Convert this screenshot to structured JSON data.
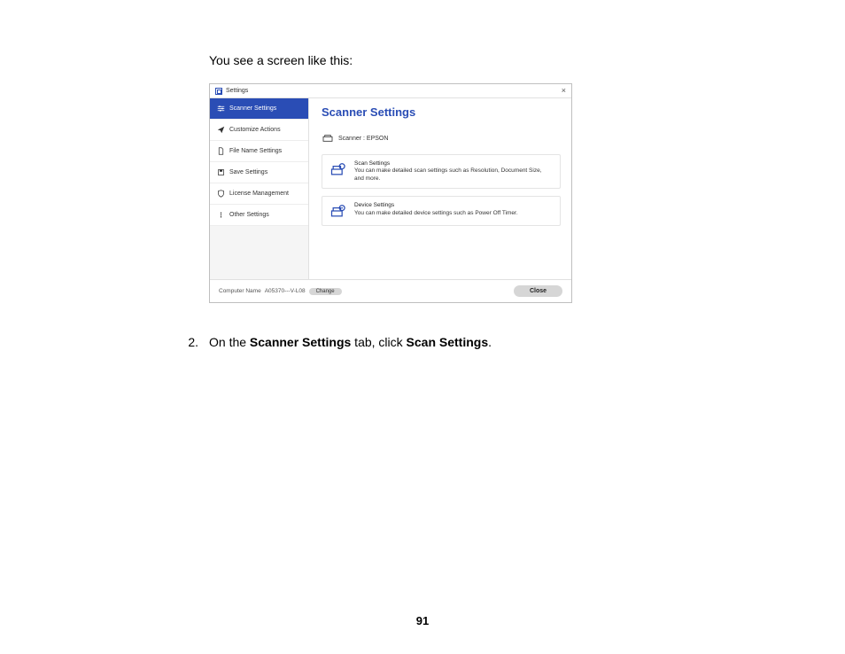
{
  "intro_text": "You see a screen like this:",
  "screenshot": {
    "window_title": "Settings",
    "close_glyph": "×",
    "sidebar": {
      "items": [
        {
          "label": "Scanner Settings"
        },
        {
          "label": "Customize Actions"
        },
        {
          "label": "File Name Settings"
        },
        {
          "label": "Save Settings"
        },
        {
          "label": "License Management"
        },
        {
          "label": "Other Settings"
        }
      ]
    },
    "main": {
      "heading": "Scanner Settings",
      "scanner_label": "Scanner :  EPSON",
      "cards": [
        {
          "title": "Scan Settings",
          "desc": "You can make detailed scan settings such as Resolution, Document Size, and more."
        },
        {
          "title": "Device Settings",
          "desc": "You can make detailed device settings such as Power Off Timer."
        }
      ]
    },
    "footer": {
      "computer_name_label": "Computer Name",
      "computer_name_value": "A05370---V-L08",
      "change_label": "Change",
      "close_label": "Close"
    }
  },
  "step": {
    "num": "2.",
    "prefix": "On the ",
    "bold1": "Scanner Settings",
    "mid": " tab, click ",
    "bold2": "Scan Settings",
    "suffix": "."
  },
  "page_number": "91"
}
